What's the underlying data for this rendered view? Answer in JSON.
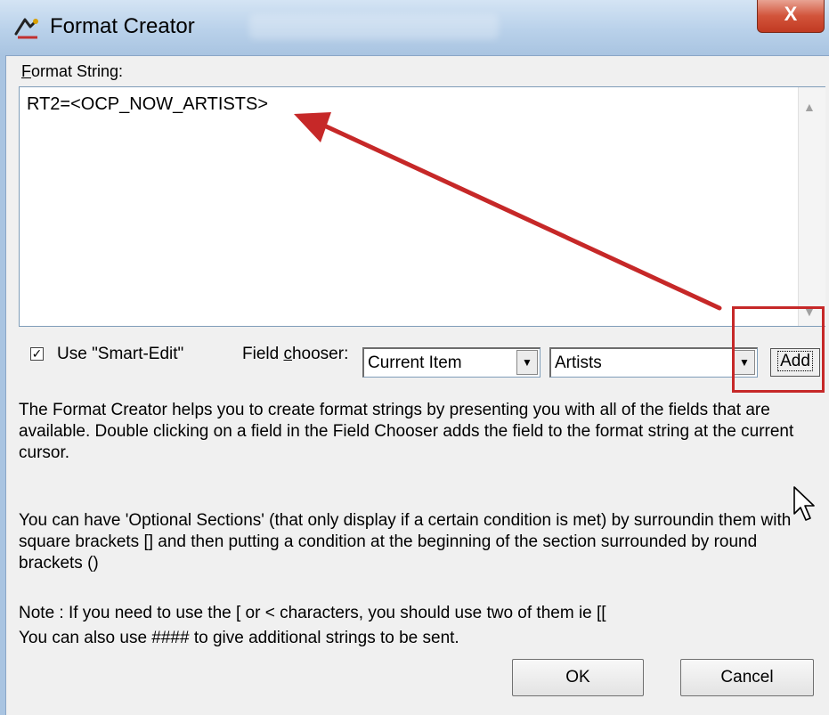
{
  "window": {
    "title": "Format Creator",
    "close_glyph": "X"
  },
  "format_string": {
    "label_accel": "F",
    "label_rest": "ormat String:",
    "value": "RT2=<OCP_NOW_ARTISTS>"
  },
  "smart_edit": {
    "checked": true,
    "check_glyph": "✓",
    "label": "Use \"Smart-Edit\""
  },
  "field_chooser": {
    "label_pre": "Field ",
    "label_accel": "c",
    "label_post": "hooser:",
    "source_value": "Current Item",
    "field_value": "Artists",
    "dropdown_glyph": "▼",
    "add_label": "Add"
  },
  "help": {
    "p1": "The Format Creator helps you to create format strings by presenting you with all of the fields that are available. Double clicking on a field in the Field Chooser adds the field to the format string at the current cursor.",
    "p2": "You can have 'Optional Sections' (that only display if a certain condition is met) by surroundin them with square brackets [] and then putting a condition at the beginning of the section surrounded by round brackets ()",
    "p3": "Note : If you need to use the [ or < characters, you should use two of them ie [[",
    "p4": "You can also use #### to give additional strings to be sent."
  },
  "buttons": {
    "ok": "OK",
    "cancel": "Cancel"
  },
  "colors": {
    "annotation_red": "#c62828"
  },
  "icons": [
    "window-app-icon",
    "close-icon",
    "scroll-up-icon",
    "scroll-down-icon",
    "dropdown-arrow-icon",
    "mouse-pointer-icon",
    "annotation-arrow"
  ]
}
